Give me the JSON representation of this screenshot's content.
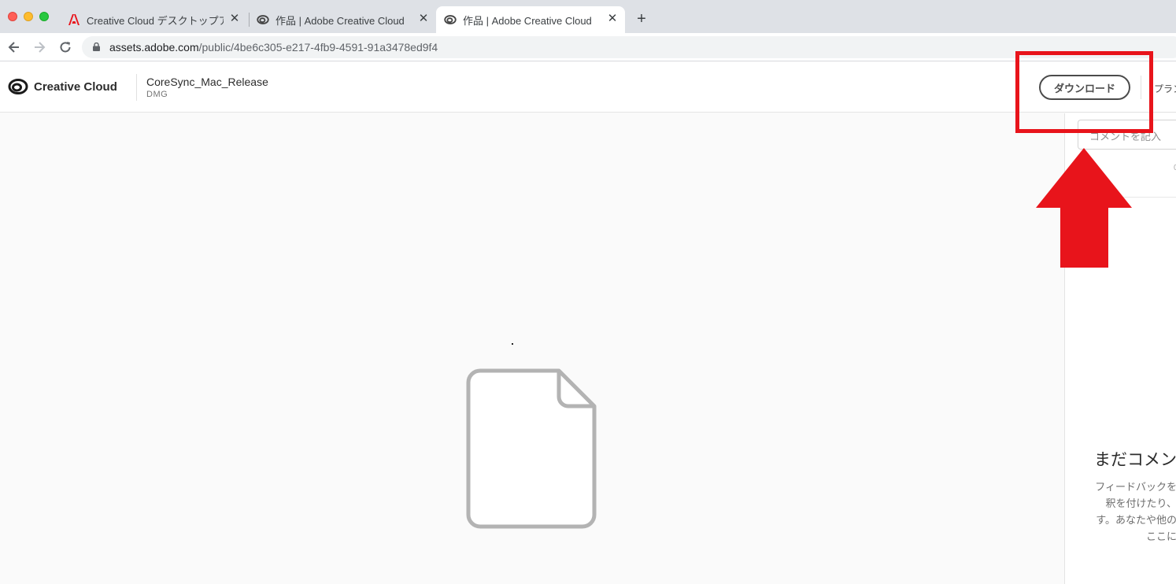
{
  "browser": {
    "tabs": [
      {
        "title": "Creative Cloud デスクトップア",
        "icon": "adobe-icon",
        "active": false
      },
      {
        "title": "作品 | Adobe Creative Cloud",
        "icon": "creative-cloud-icon",
        "active": false
      },
      {
        "title": "作品 | Adobe Creative Cloud",
        "icon": "creative-cloud-icon",
        "active": true
      }
    ],
    "close_glyph": "✕",
    "new_tab_glyph": "+",
    "url_host": "assets.adobe.com",
    "url_path": "/public/4be6c305-e217-4fb9-4591-91a3478ed9f4"
  },
  "header": {
    "brand": "Creative Cloud",
    "file_name": "CoreSync_Mac_Release",
    "file_type": "DMG",
    "download_label": "ダウンロード",
    "plan_label": "プラン"
  },
  "side_panel": {
    "comment_placeholder": "コメントを記入",
    "mini_text": "0",
    "empty_title": "まだコメン",
    "empty_lines": [
      "フィードバックを",
      "釈を付けたり、",
      "す。あなたや他の",
      "ここに"
    ]
  },
  "annotation": {
    "highlight_color": "#e8141b"
  }
}
